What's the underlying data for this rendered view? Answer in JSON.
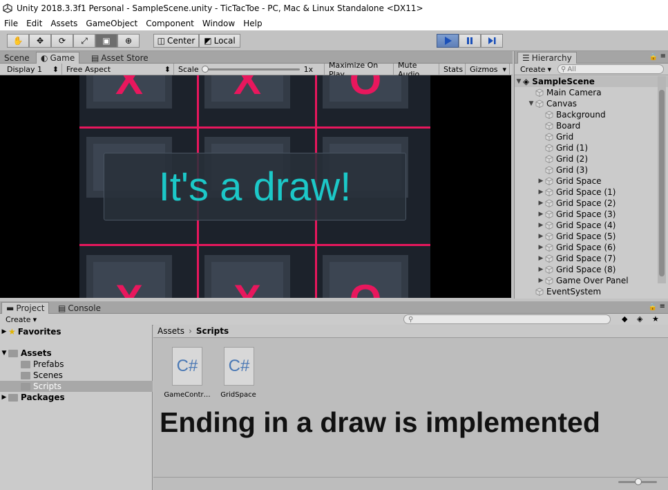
{
  "window": {
    "title": "Unity 2018.3.3f1 Personal - SampleScene.unity - TicTacToe - PC, Mac & Linux Standalone <DX11>"
  },
  "menu": [
    "File",
    "Edit",
    "Assets",
    "GameObject",
    "Component",
    "Window",
    "Help"
  ],
  "toolbar": {
    "center_label": "Center",
    "local_label": "Local"
  },
  "scene_tabs": {
    "scene": "Scene",
    "game": "Game",
    "asset_store": "Asset Store"
  },
  "game_bar": {
    "display": "Display 1",
    "aspect": "Free Aspect",
    "scale_label": "Scale",
    "scale_value": "1x",
    "maximize": "Maximize On Play",
    "mute": "Mute Audio",
    "stats": "Stats",
    "gizmos": "Gizmos"
  },
  "game": {
    "message": "It's a draw!",
    "marks": {
      "top": [
        "X",
        "X",
        "O"
      ],
      "bottom": [
        "X",
        "X",
        "O"
      ]
    },
    "accent": "#e8175d",
    "message_color": "#1cc8c8"
  },
  "hierarchy": {
    "tab": "Hierarchy",
    "create": "Create",
    "search_placeholder": "All",
    "scene": "SampleScene",
    "items": [
      {
        "label": "Main Camera",
        "indent": 1,
        "expand": false
      },
      {
        "label": "Canvas",
        "indent": 1,
        "expand": true
      },
      {
        "label": "Background",
        "indent": 2,
        "expand": false
      },
      {
        "label": "Board",
        "indent": 2,
        "expand": false
      },
      {
        "label": "Grid",
        "indent": 2,
        "expand": false
      },
      {
        "label": "Grid (1)",
        "indent": 2,
        "expand": false
      },
      {
        "label": "Grid (2)",
        "indent": 2,
        "expand": false
      },
      {
        "label": "Grid (3)",
        "indent": 2,
        "expand": false
      },
      {
        "label": "Grid Space",
        "indent": 2,
        "expand": true
      },
      {
        "label": "Grid Space (1)",
        "indent": 2,
        "expand": true
      },
      {
        "label": "Grid Space (2)",
        "indent": 2,
        "expand": true
      },
      {
        "label": "Grid Space (3)",
        "indent": 2,
        "expand": true
      },
      {
        "label": "Grid Space (4)",
        "indent": 2,
        "expand": true
      },
      {
        "label": "Grid Space (5)",
        "indent": 2,
        "expand": true
      },
      {
        "label": "Grid Space (6)",
        "indent": 2,
        "expand": true
      },
      {
        "label": "Grid Space (7)",
        "indent": 2,
        "expand": true
      },
      {
        "label": "Grid Space (8)",
        "indent": 2,
        "expand": true
      },
      {
        "label": "Game Over Panel",
        "indent": 2,
        "expand": true
      },
      {
        "label": "EventSystem",
        "indent": 1,
        "expand": false
      }
    ]
  },
  "project": {
    "tab": "Project",
    "console_tab": "Console",
    "create": "Create",
    "favorites": "Favorites",
    "assets": "Assets",
    "asset_folders": [
      "Prefabs",
      "Scenes",
      "Scripts"
    ],
    "packages": "Packages",
    "breadcrumb": [
      "Assets",
      "Scripts"
    ],
    "files": [
      {
        "icon": "C#",
        "name": "GameContr…"
      },
      {
        "icon": "C#",
        "name": "GridSpace"
      }
    ]
  },
  "caption": "Ending in a draw is implemented"
}
